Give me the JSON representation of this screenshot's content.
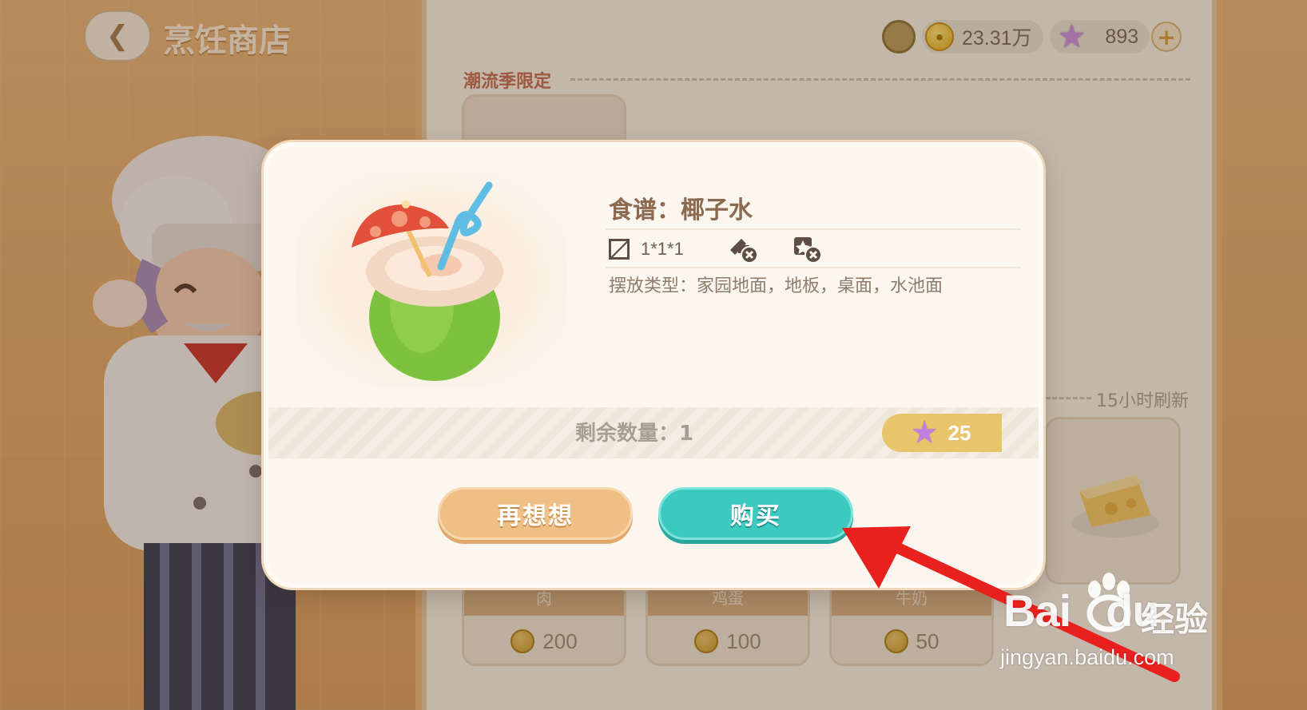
{
  "header": {
    "back_icon": "chevron-left-icon",
    "title": "烹饪商店"
  },
  "currency": {
    "coins": "23.31万",
    "stars": "893",
    "plus": "+",
    "coin_icon": "gold-coin-icon",
    "star_icon": "purple-star-icon"
  },
  "shop": {
    "section_title": "潮流季限定",
    "refresh_text": "15小时刷新",
    "items": [
      {
        "name": "肉",
        "price": "200"
      },
      {
        "name": "鸡蛋",
        "price": "100"
      },
      {
        "name": "牛奶",
        "price": "50"
      }
    ]
  },
  "dialog": {
    "recipe_title": "食谱：椰子水",
    "item_icon": "coconut-drink-icon",
    "size": "1*1*1",
    "attr_icons": [
      "no-giftable-icon",
      "no-collectable-icon"
    ],
    "placement": "摆放类型：家园地面，地板，桌面，水池面",
    "stock": "剩余数量：1",
    "price": "25",
    "cancel_label": "再想想",
    "buy_label": "购买"
  },
  "watermark": {
    "logo_text": "Bai",
    "logo_text2": "du",
    "jingyan": "经验",
    "url": "jingyan.baidu.com"
  },
  "colors": {
    "buy_button": "#3ccac0",
    "cancel_button": "#efbf85",
    "price_tag": "#e8c46a",
    "annotation_arrow": "#e8201e"
  }
}
